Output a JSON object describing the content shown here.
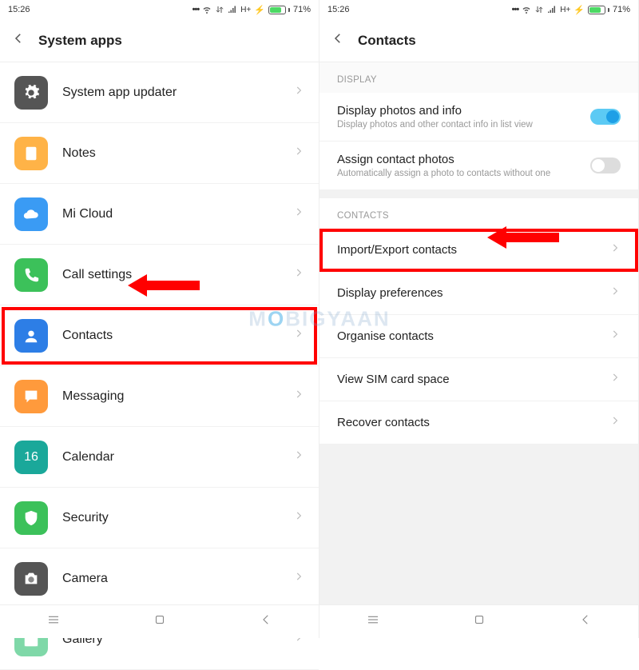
{
  "status": {
    "time": "15:26",
    "battery_pct": "71%"
  },
  "left": {
    "title": "System apps",
    "items": [
      {
        "label": "System app updater",
        "icon": "gear",
        "color": "#555"
      },
      {
        "label": "Notes",
        "icon": "notes",
        "color": "#ffb347"
      },
      {
        "label": "Mi Cloud",
        "icon": "cloud",
        "color": "#3a9bf4"
      },
      {
        "label": "Call settings",
        "icon": "phone",
        "color": "#3cc15a"
      },
      {
        "label": "Contacts",
        "icon": "contacts",
        "color": "#2d7ee6",
        "highlight": true
      },
      {
        "label": "Messaging",
        "icon": "message",
        "color": "#ff9a3c"
      },
      {
        "label": "Calendar",
        "icon": "calendar",
        "color": "#1aa89a",
        "text": "16"
      },
      {
        "label": "Security",
        "icon": "shield",
        "color": "#3cc15a"
      },
      {
        "label": "Camera",
        "icon": "camera",
        "color": "#555"
      },
      {
        "label": "Gallery",
        "icon": "gallery",
        "color": "#7fd8a8"
      }
    ]
  },
  "right": {
    "title": "Contacts",
    "section_display": "DISPLAY",
    "display_rows": [
      {
        "t1": "Display photos and info",
        "t2": "Display photos and other contact info in list view",
        "toggle": "on"
      },
      {
        "t1": "Assign contact photos",
        "t2": "Automatically assign a photo to contacts without one",
        "toggle": "off"
      }
    ],
    "section_contacts": "CONTACTS",
    "contact_rows": [
      {
        "t1": "Import/Export contacts",
        "highlight": true
      },
      {
        "t1": "Display preferences"
      },
      {
        "t1": "Organise contacts"
      },
      {
        "t1": "View SIM card space"
      },
      {
        "t1": "Recover contacts"
      }
    ]
  },
  "watermark": "MOBIGYAAN"
}
